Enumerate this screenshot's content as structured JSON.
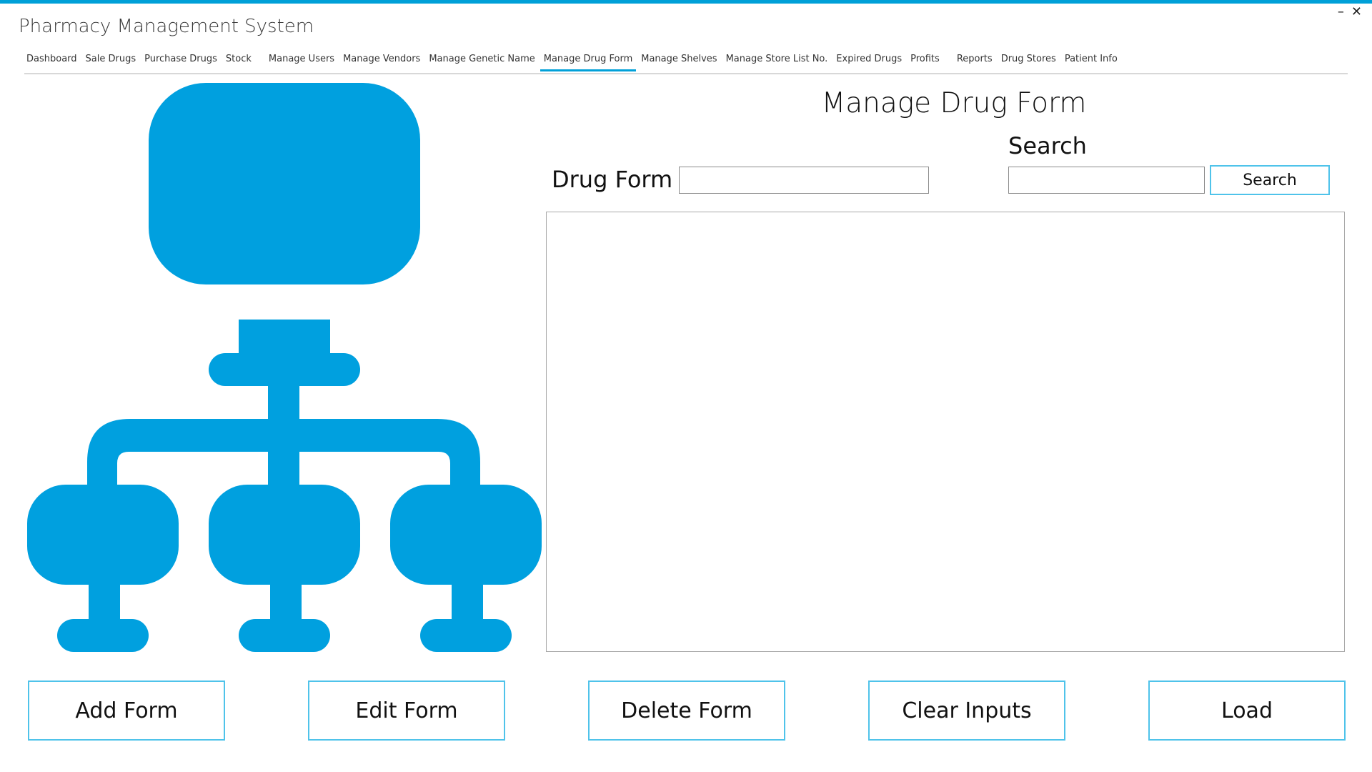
{
  "app": {
    "title": "Pharmacy Management System"
  },
  "window_controls": {
    "minimize": "–",
    "close": "✕"
  },
  "menu": [
    {
      "label": "Dashboard"
    },
    {
      "label": "Sale Drugs"
    },
    {
      "label": "Purchase Drugs"
    },
    {
      "label": "Stock"
    },
    {
      "label": "Manage Users"
    },
    {
      "label": "Manage Vendors"
    },
    {
      "label": "Manage Genetic Name"
    },
    {
      "label": "Manage Drug Form",
      "active": true
    },
    {
      "label": "Manage Shelves"
    },
    {
      "label": "Manage Store List No."
    },
    {
      "label": "Expired Drugs"
    },
    {
      "label": "Profits"
    },
    {
      "label": "Reports"
    },
    {
      "label": "Drug Stores"
    },
    {
      "label": "Patient Info"
    }
  ],
  "page": {
    "title": "Manage Drug Form",
    "drug_form_label": "Drug Form",
    "drug_form_value": "",
    "search_label": "Search",
    "search_value": "",
    "search_button": "Search"
  },
  "buttons": {
    "add": "Add Form",
    "edit": "Edit Form",
    "delete": "Delete Form",
    "clear": "Clear Inputs",
    "load": "Load"
  },
  "colors": {
    "accent": "#00a0d8",
    "button_border": "#4fc3ea"
  },
  "icons": {
    "illustration": "hierarchy-icon"
  }
}
